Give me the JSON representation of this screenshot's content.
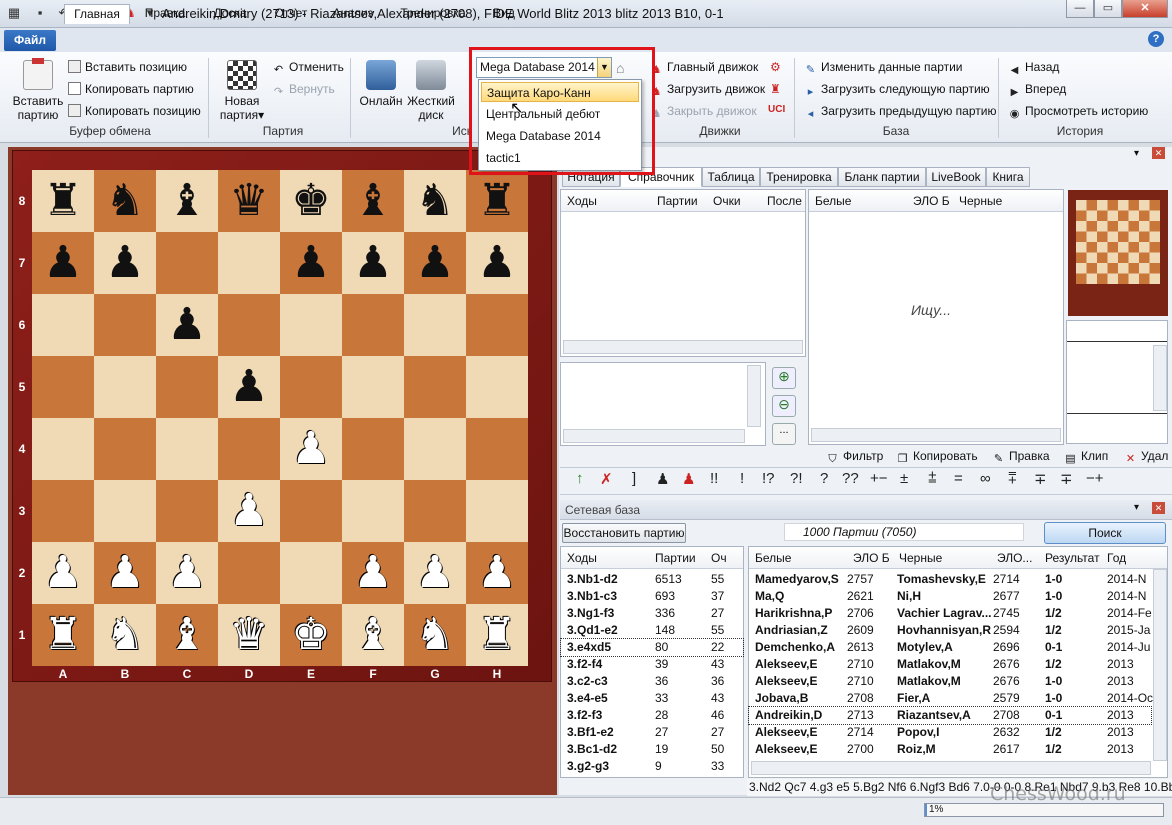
{
  "window": {
    "title": "Andreikin,Dmitry (2713) - Riazantsev,Alexander (2708), FIDE World Blitz 2013 blitz 2013  B10, 0-1"
  },
  "ribbon": {
    "file_tab": "Файл",
    "tabs": [
      "Главная",
      "Правка",
      "Доска",
      "Отчет",
      "Анализ",
      "Тренировка",
      "Вид"
    ],
    "clipboard": {
      "paste_big": "Вставить партию",
      "paste_pos": "Вставить позицию",
      "copy_game": "Копировать партию",
      "copy_pos": "Копировать позицию",
      "group": "Буфер обмена"
    },
    "game": {
      "new_game": "Новая партия",
      "undo": "Отменить",
      "redo": "Вернуть",
      "group": "Партия"
    },
    "search": {
      "online": "Онлайн",
      "harddisk": "Жесткий диск",
      "group": "Иск"
    },
    "engines": {
      "main": "Главный движок",
      "load": "Загрузить движок",
      "close": "Закрыть движок",
      "group": "Движки"
    },
    "base": {
      "edit": "Изменить данные партии",
      "load_next": "Загрузить следующую партию",
      "load_prev": "Загрузить предыдущую партию",
      "group": "База"
    },
    "history": {
      "back": "Назад",
      "forward": "Вперед",
      "view": "Просмотреть историю",
      "group": "История"
    }
  },
  "db_dropdown": {
    "value": "Mega Database 2014",
    "options": [
      "Защита Каро-Канн",
      "Центральный дебют",
      "Mega Database 2014",
      "tactic1"
    ],
    "highlighted_index": 0
  },
  "board": {
    "ranks": [
      "8",
      "7",
      "6",
      "5",
      "4",
      "3",
      "2",
      "1"
    ],
    "files": [
      "A",
      "B",
      "C",
      "D",
      "E",
      "F",
      "G",
      "H"
    ],
    "position": [
      [
        "r",
        "n",
        "b",
        "q",
        "k",
        "b",
        "n",
        "r"
      ],
      [
        "p",
        "p",
        "",
        "",
        "p",
        "p",
        "p",
        "p"
      ],
      [
        "",
        "",
        "p",
        "",
        "",
        "",
        "",
        ""
      ],
      [
        "",
        "",
        "",
        "p",
        "",
        "",
        "",
        ""
      ],
      [
        "",
        "",
        "",
        "",
        "P",
        "",
        "",
        ""
      ],
      [
        "",
        "",
        "",
        "P",
        "",
        "",
        "",
        ""
      ],
      [
        "P",
        "P",
        "P",
        "",
        "",
        "P",
        "P",
        "P"
      ],
      [
        "R",
        "N",
        "B",
        "Q",
        "K",
        "B",
        "N",
        "R"
      ]
    ]
  },
  "panels": {
    "tabs": [
      "Нотация",
      "Справочник",
      "Таблица",
      "Тренировка",
      "Бланк партии",
      "LiveBook",
      "Книга"
    ],
    "active_tab": "Справочник",
    "ref_cols": [
      "Ходы",
      "Партии",
      "Очки",
      "После"
    ],
    "games_cols": [
      "Белые",
      "ЭЛО Б",
      "Черные"
    ],
    "searching": "Ищу...",
    "games_toolbar": [
      "Фильтр",
      "Копировать",
      "Правка",
      "Клип",
      "Удал"
    ],
    "annotation_symbols": [
      "]",
      "!!",
      "!",
      "!?",
      "?!",
      "?",
      "??",
      "+−",
      "±",
      "⩲",
      "=",
      "∞",
      "⩱",
      "∓",
      "−+"
    ],
    "net_title": "Сетевая база",
    "restore_btn": "Восстановить партию",
    "count": "1000 Партии (7050)",
    "search_btn": "Поиск",
    "moves_cols": [
      "Ходы",
      "Партии",
      "Оч"
    ],
    "moves": [
      [
        "3.Nb1-d2",
        "6513",
        "55"
      ],
      [
        "3.Nb1-c3",
        "693",
        "37"
      ],
      [
        "3.Ng1-f3",
        "336",
        "27"
      ],
      [
        "3.Qd1-e2",
        "148",
        "55"
      ],
      [
        "3.e4xd5",
        "80",
        "22"
      ],
      [
        "3.f2-f4",
        "39",
        "43"
      ],
      [
        "3.c2-c3",
        "36",
        "36"
      ],
      [
        "3.e4-e5",
        "33",
        "43"
      ],
      [
        "3.f2-f3",
        "28",
        "46"
      ],
      [
        "3.Bf1-e2",
        "27",
        "27"
      ],
      [
        "3.Bc1-d2",
        "19",
        "50"
      ],
      [
        "3.g2-g3",
        "9",
        "33"
      ]
    ],
    "list_cols": [
      "Белые",
      "ЭЛО Б",
      "Черные",
      "ЭЛО...",
      "Результат",
      "Год"
    ],
    "games": [
      [
        "Mamedyarov,S",
        "2757",
        "Tomashevsky,E",
        "2714",
        "1-0",
        "2014-N"
      ],
      [
        "Ma,Q",
        "2621",
        "Ni,H",
        "2677",
        "1-0",
        "2014-N"
      ],
      [
        "Harikrishna,P",
        "2706",
        "Vachier Lagrav...",
        "2745",
        "1/2",
        "2014-Fe"
      ],
      [
        "Andriasian,Z",
        "2609",
        "Hovhannisyan,R",
        "2594",
        "1/2",
        "2015-Ja"
      ],
      [
        "Demchenko,A",
        "2613",
        "Motylev,A",
        "2696",
        "0-1",
        "2014-Ju"
      ],
      [
        "Alekseev,E",
        "2710",
        "Matlakov,M",
        "2676",
        "1/2",
        "2013"
      ],
      [
        "Alekseev,E",
        "2710",
        "Matlakov,M",
        "2676",
        "1-0",
        "2013"
      ],
      [
        "Jobava,B",
        "2708",
        "Fier,A",
        "2579",
        "1-0",
        "2014-Oc"
      ],
      [
        "Andreikin,D",
        "2713",
        "Riazantsev,A",
        "2708",
        "0-1",
        "2013"
      ],
      [
        "Alekseev,E",
        "2714",
        "Popov,I",
        "2632",
        "1/2",
        "2013"
      ],
      [
        "Alekseev,E",
        "2700",
        "Roiz,M",
        "2617",
        "1/2",
        "2013"
      ]
    ],
    "game_moves_line": "3.Nd2 Qc7 4.g3 e5 5.Bg2 Nf6 6.Ngf3 Bd6 7.0-0 0-0 8.Re1 Nbd7 9.b3 Re8 10.Bb2"
  },
  "status": {
    "progress": "1%"
  },
  "watermark": "ChessWood.ru"
}
